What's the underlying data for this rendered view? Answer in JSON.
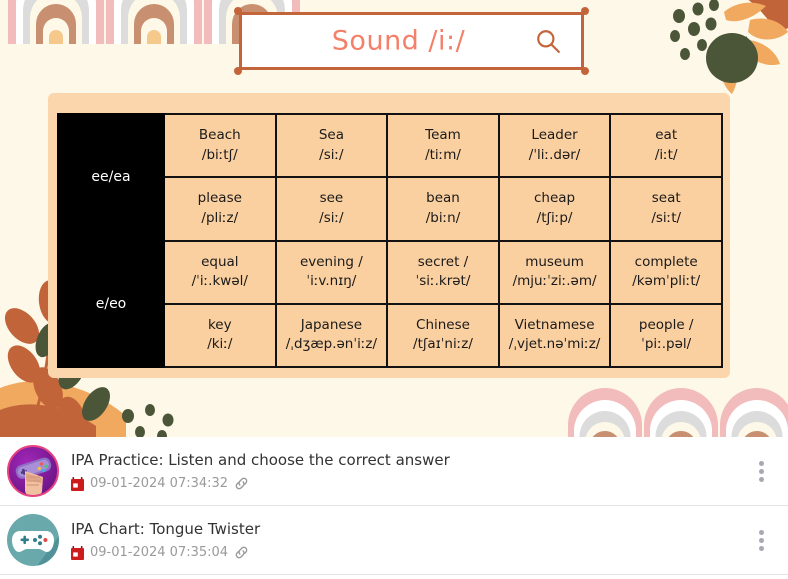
{
  "search": {
    "value": "Sound /i:/",
    "icon": "search-icon"
  },
  "table": {
    "rows": [
      {
        "header": "ee/ea",
        "lines": [
          [
            {
              "word": "Beach",
              "ipa": "/biːtʃ/"
            },
            {
              "word": "Sea",
              "ipa": "/siː/"
            },
            {
              "word": "Team",
              "ipa": "/tiːm/"
            },
            {
              "word": "Leader",
              "ipa": "/ˈliː.dər/"
            },
            {
              "word": "eat",
              "ipa": "/iːt/"
            }
          ],
          [
            {
              "word": "please",
              "ipa": "/pliːz/"
            },
            {
              "word": "see",
              "ipa": "/siː/"
            },
            {
              "word": "bean",
              "ipa": "/biːn/"
            },
            {
              "word": "cheap",
              "ipa": "/tʃiːp/"
            },
            {
              "word": "seat",
              "ipa": "/siːt/"
            }
          ]
        ]
      },
      {
        "header": "e/eo",
        "lines": [
          [
            {
              "word": "equal",
              "ipa": "/ˈiː.kwəl/"
            },
            {
              "word": "evening /",
              "ipa": "ˈiːv.nɪŋ/"
            },
            {
              "word": "secret  /",
              "ipa": "ˈsiː.krət/"
            },
            {
              "word": "museum",
              "ipa": "/mjuːˈziː.əm/"
            },
            {
              "word": "complete",
              "ipa": "/kəmˈpliːt/"
            }
          ],
          [
            {
              "word": "key",
              "ipa": "/kiː/"
            },
            {
              "word": "Japanese",
              "ipa": "/ˌdʒæp.ənˈiːz/"
            },
            {
              "word": "Chinese",
              "ipa": "/tʃaɪˈniːz/"
            },
            {
              "word": "Vietnamese",
              "ipa": "/ˌvjet.nəˈmiːz/"
            },
            {
              "word": "people /",
              "ipa": "ˈpiː.pəl/"
            }
          ]
        ]
      }
    ]
  },
  "list": {
    "items": [
      {
        "avatar": "gamepad-fist-avatar",
        "title": "IPA Practice: Listen and choose the correct answer",
        "date": "09-01-2024 07:34:32",
        "calendar_icon": "calendar-icon",
        "link_icon": "link-icon",
        "menu_icon": "kebab-menu-icon"
      },
      {
        "avatar": "gamepad-avatar",
        "title": "IPA Chart: Tongue Twister",
        "date": "09-01-2024 07:35:04",
        "calendar_icon": "calendar-icon",
        "link_icon": "link-icon",
        "menu_icon": "kebab-menu-icon"
      }
    ]
  },
  "colors": {
    "poster_bg": "#fdf8e8",
    "card_bg": "#fbd5ab",
    "cell_bg": "#fbd0a0",
    "search_text": "#f4806a",
    "search_border": "#c3643a",
    "date_text": "#9a9a9a",
    "calendar_red": "#cc1d1d"
  }
}
